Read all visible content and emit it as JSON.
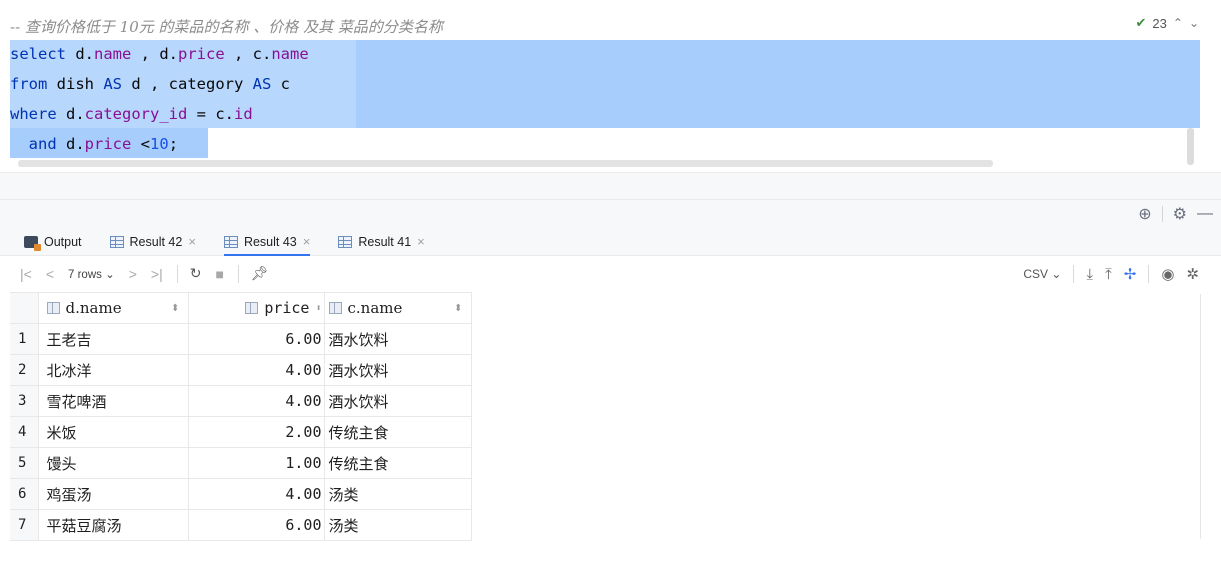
{
  "editor": {
    "comment": "-- 查询价格低于 10元 的菜品的名称 、价格 及其 菜品的分类名称",
    "inspection_count": "23",
    "sql": {
      "line1": {
        "k1": "select",
        "t1": " d.",
        "f1": "name",
        "t2": " , d.",
        "f2": "price",
        "t3": " , c.",
        "f3": "name"
      },
      "line2": {
        "k1": "from",
        "t1": " dish ",
        "k2": "AS",
        "t2": " d , category ",
        "k3": "AS",
        "t3": " c"
      },
      "line3": {
        "k1": "where",
        "t1": " d.",
        "f1": "category_id",
        "t2": " = c.",
        "f2": "id"
      },
      "line4": {
        "k1": "  and",
        "t1": " d.",
        "f1": "price",
        "t2": " <",
        "n1": "10",
        "t3": ";"
      }
    }
  },
  "tabs": [
    {
      "label": "Output",
      "icon": "output-icon",
      "closable": false
    },
    {
      "label": "Result 42",
      "icon": "table-icon",
      "closable": true
    },
    {
      "label": "Result 43",
      "icon": "table-icon",
      "closable": true,
      "active": true
    },
    {
      "label": "Result 41",
      "icon": "table-icon",
      "closable": true
    }
  ],
  "toolbar": {
    "rows_label": "7 rows",
    "export_format": "CSV"
  },
  "grid": {
    "columns": [
      "d.name",
      "price",
      "c.name"
    ],
    "rows": [
      {
        "n": "1",
        "name": "王老吉",
        "price": "6.00",
        "category": "酒水饮料"
      },
      {
        "n": "2",
        "name": "北冰洋",
        "price": "4.00",
        "category": "酒水饮料"
      },
      {
        "n": "3",
        "name": "雪花啤酒",
        "price": "4.00",
        "category": "酒水饮料"
      },
      {
        "n": "4",
        "name": "米饭",
        "price": "2.00",
        "category": "传统主食"
      },
      {
        "n": "5",
        "name": "馒头",
        "price": "1.00",
        "category": "传统主食"
      },
      {
        "n": "6",
        "name": "鸡蛋汤",
        "price": "4.00",
        "category": "汤类"
      },
      {
        "n": "7",
        "name": "平菇豆腐汤",
        "price": "6.00",
        "category": "汤类"
      }
    ]
  },
  "colors": {
    "selection": "#a6cdfb",
    "keyword": "#0033b3",
    "field": "#871094",
    "number": "#1750eb",
    "accent": "#3574f0"
  }
}
